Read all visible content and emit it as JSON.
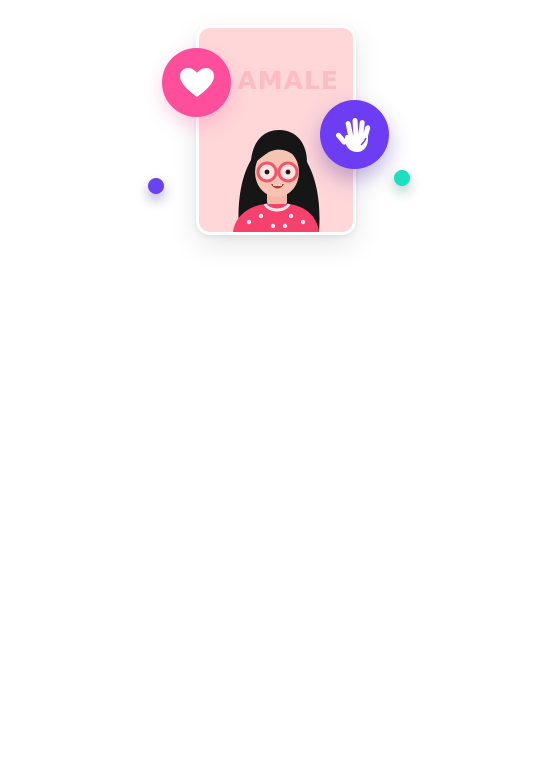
{
  "card": {
    "title": "AMALE",
    "background_color": "#ffd7d9",
    "title_color": "#fcbcc2"
  },
  "badges": {
    "like": {
      "icon": "heart-icon",
      "color": "#ff4e9b"
    },
    "wave": {
      "icon": "waving-hand-icon",
      "color": "#6d3df3"
    }
  },
  "decorations": {
    "purple_dot_color": "#6a42f0",
    "teal_dot_color": "#1de0c0"
  }
}
